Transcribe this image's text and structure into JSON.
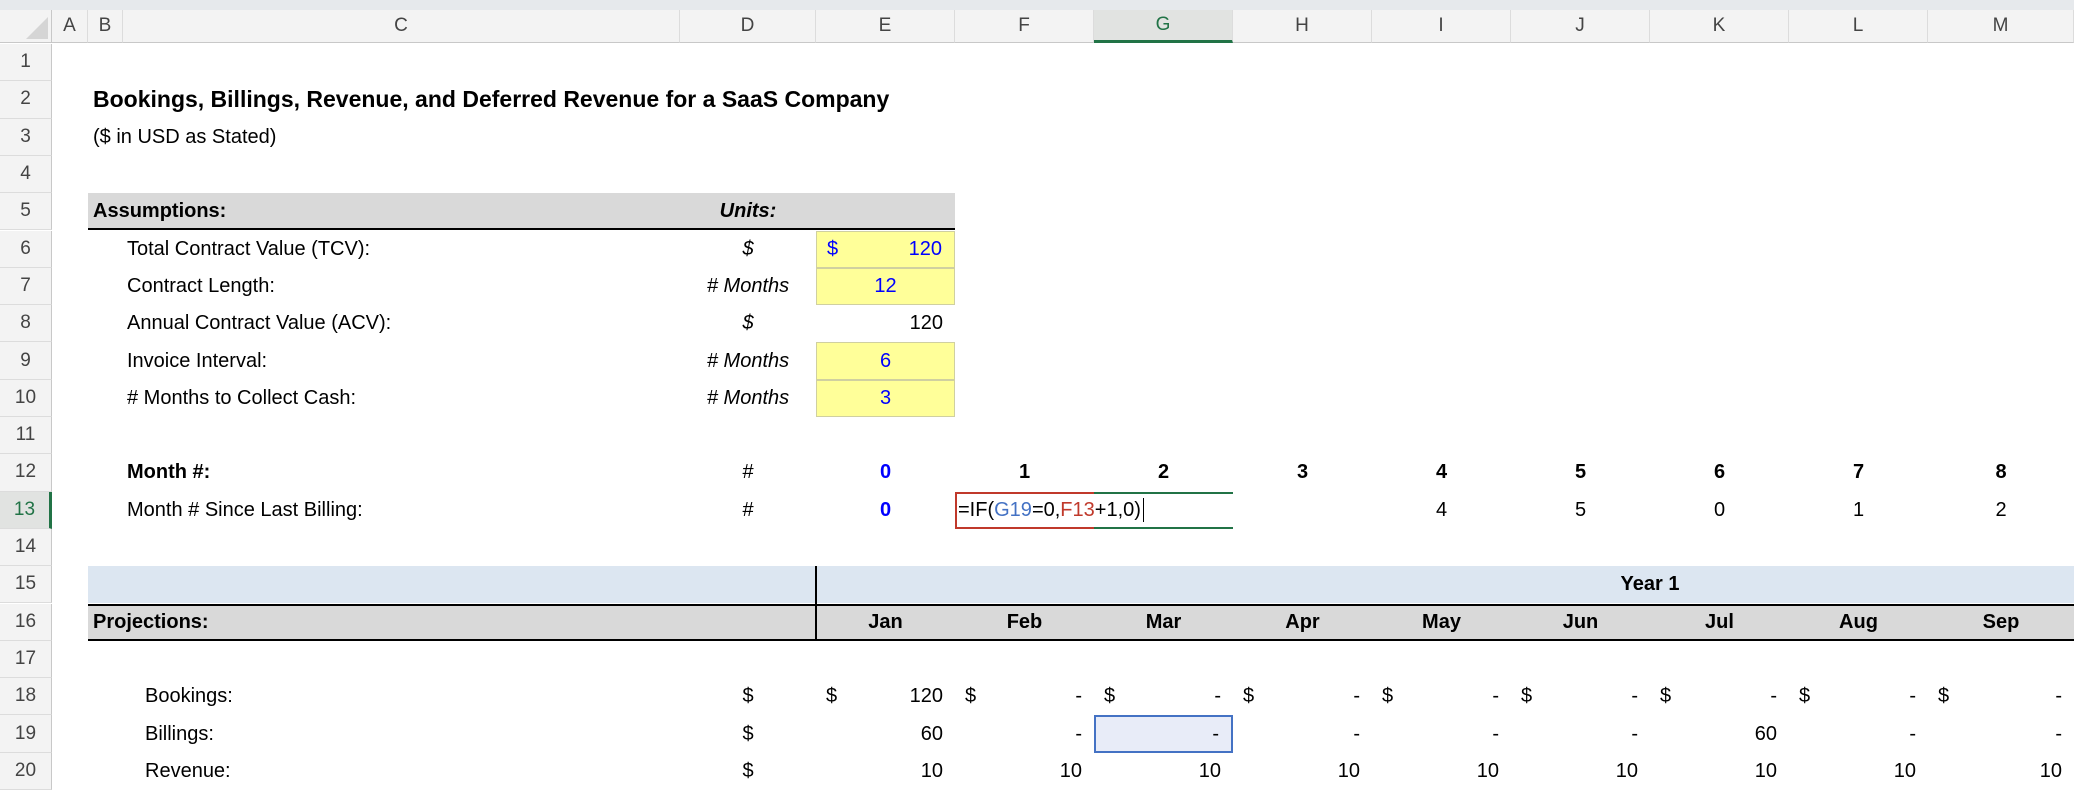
{
  "sheet": {
    "columns": [
      "A",
      "B",
      "C",
      "D",
      "E",
      "F",
      "G",
      "H",
      "I",
      "J",
      "K",
      "L",
      "M"
    ],
    "selected_column": "G",
    "rows_visible": [
      1,
      2,
      3,
      4,
      5,
      6,
      7,
      8,
      9,
      10,
      11,
      12,
      13,
      14,
      15,
      16,
      17,
      18,
      19,
      20
    ],
    "selected_row": 13,
    "colors": {
      "input_fill": "#ffff99",
      "input_text": "#0000ff",
      "header_band": "#d9d9d9",
      "year_band": "#dce6f1",
      "selection_green": "#217346"
    }
  },
  "title": "Bookings, Billings, Revenue, and Deferred Revenue for a SaaS Company",
  "subtitle": "($ in USD as Stated)",
  "assumptions": {
    "header": "Assumptions:",
    "units_header": "Units:",
    "items": [
      {
        "label": "Total Contract Value (TCV):",
        "unit": "$",
        "symbol": "$",
        "value": "120"
      },
      {
        "label": "Contract Length:",
        "unit": "# Months",
        "value": "12"
      },
      {
        "label": "Annual Contract Value (ACV):",
        "unit": "$",
        "value": "120"
      },
      {
        "label": "Invoice Interval:",
        "unit": "# Months",
        "value": "6"
      },
      {
        "label": "# Months to Collect Cash:",
        "unit": "# Months",
        "value": "3"
      }
    ]
  },
  "month_row": {
    "label": "Month #:",
    "unit": "#",
    "values": [
      "0",
      "1",
      "2",
      "3",
      "4",
      "5",
      "6",
      "7",
      "8"
    ]
  },
  "since_billing_row": {
    "label": "Month # Since Last Billing:",
    "unit": "#",
    "values": [
      "0",
      "",
      "",
      "",
      "4",
      "5",
      "0",
      "1",
      "2"
    ]
  },
  "formula": {
    "prefix": "=IF(",
    "ref1": "G19",
    "mid": "=0,",
    "ref2": "F13",
    "suffix": "+1,0)"
  },
  "projections": {
    "year_label": "Year 1",
    "header": "Projections:",
    "months": [
      "Jan",
      "Feb",
      "Mar",
      "Apr",
      "May",
      "Jun",
      "Jul",
      "Aug",
      "Sep"
    ],
    "rows": [
      {
        "label": "Bookings:",
        "unit": "$",
        "symbol": "$",
        "values": [
          "120",
          "-",
          "-",
          "-",
          "-",
          "-",
          "-",
          "-",
          "-"
        ]
      },
      {
        "label": "Billings:",
        "unit": "$",
        "values": [
          "60",
          "-",
          "-",
          "-",
          "-",
          "-",
          "60",
          "-",
          "-"
        ]
      },
      {
        "label": "Revenue:",
        "unit": "$",
        "values": [
          "10",
          "10",
          "10",
          "10",
          "10",
          "10",
          "10",
          "10",
          "10"
        ]
      }
    ]
  }
}
